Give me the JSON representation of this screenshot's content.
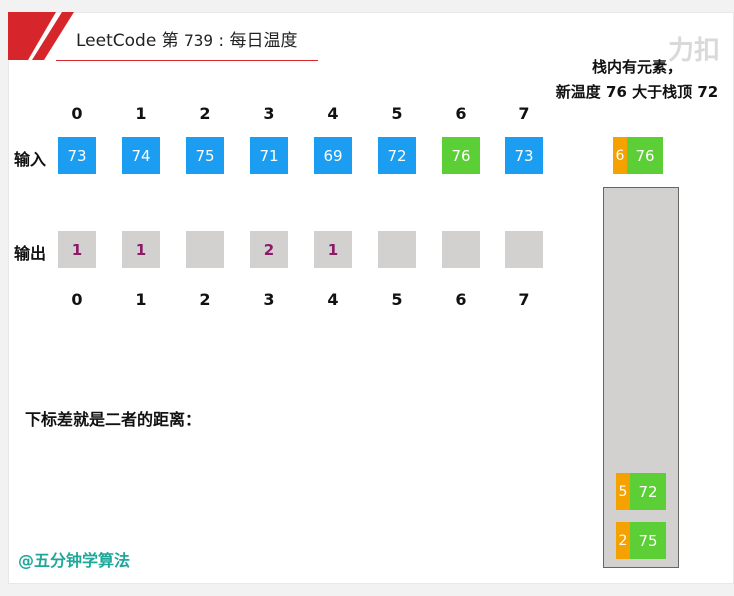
{
  "title": {
    "prefix": "LeetCode",
    "middle": " 第 ",
    "number": "739",
    "separator": " : ",
    "name": "每日温度"
  },
  "watermark": "力扣",
  "caption": {
    "line1": "栈内有元素，",
    "line2": "新温度 76 大于栈顶 72"
  },
  "input": {
    "label": "输入",
    "indices": [
      "0",
      "1",
      "2",
      "3",
      "4",
      "5",
      "6",
      "7"
    ],
    "values": [
      "73",
      "74",
      "75",
      "71",
      "69",
      "72",
      "76",
      "73"
    ],
    "highlight_index": 6
  },
  "output": {
    "label": "输出",
    "indices": [
      "0",
      "1",
      "2",
      "3",
      "4",
      "5",
      "6",
      "7"
    ],
    "values": [
      "1",
      "1",
      "",
      "2",
      "1",
      "",
      "",
      ""
    ]
  },
  "incoming": {
    "index": "6",
    "value": "76"
  },
  "stack": [
    {
      "index": "5",
      "value": "72"
    },
    {
      "index": "2",
      "value": "75"
    }
  ],
  "note": "下标差就是二者的距离：",
  "signature": "@五分钟学算法",
  "colors": {
    "input_cell": "#1b9ef2",
    "highlight_cell": "#5bcf35",
    "output_cell": "#d3d0d0",
    "output_text": "#8c1a66",
    "stack_index": "#f5a200",
    "title_accent": "#d7262b",
    "signature": "#1fa89a"
  }
}
